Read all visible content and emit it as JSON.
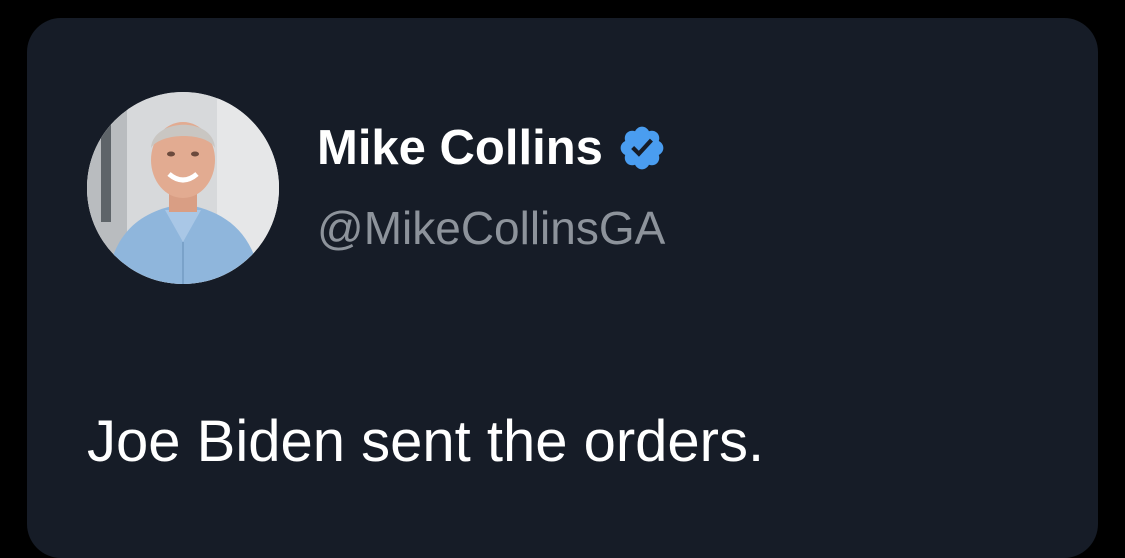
{
  "tweet": {
    "display_name": "Mike Collins",
    "handle": "@MikeCollinsGA",
    "text": "Joe Biden sent the orders.",
    "verified": true,
    "verified_badge_icon": "verified-check-icon",
    "verified_color": "#4a9df0"
  },
  "colors": {
    "page_background": "#000000",
    "card_background": "#161c27",
    "name_color": "#ffffff",
    "handle_color": "#8d939b",
    "text_color": "#ffffff"
  }
}
